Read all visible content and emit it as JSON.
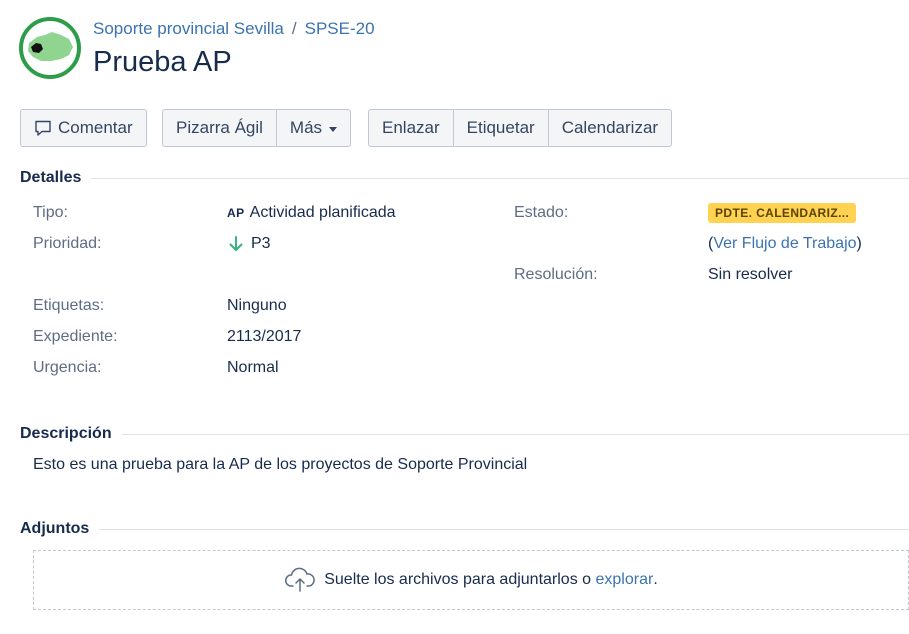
{
  "breadcrumb": {
    "project": "Soporte provincial Sevilla",
    "separator": "/",
    "issue_key": "SPSE-20"
  },
  "issue": {
    "title": "Prueba AP"
  },
  "toolbar": {
    "comment_label": "Comentar",
    "board_label": "Pizarra Ágil",
    "more_label": "Más",
    "link_label": "Enlazar",
    "label_label": "Etiquetar",
    "schedule_label": "Calendarizar"
  },
  "details": {
    "heading": "Detalles",
    "type": {
      "label": "Tipo:",
      "icon_text": "AP",
      "value": "Actividad planificada"
    },
    "priority": {
      "label": "Prioridad:",
      "value": "P3",
      "color": "#36b37e"
    },
    "labels": {
      "label": "Etiquetas:",
      "value": "Ninguno"
    },
    "expediente": {
      "label": "Expediente:",
      "value": "2113/2017"
    },
    "urgency": {
      "label": "Urgencia:",
      "value": "Normal"
    },
    "status": {
      "label": "Estado:",
      "value": "PDTE. CALENDARIZ...",
      "color": "#ffd351",
      "workflow_open": "(",
      "workflow_link": "Ver Flujo de Trabajo",
      "workflow_close": ")"
    },
    "resolution": {
      "label": "Resolución:",
      "value": "Sin resolver"
    }
  },
  "description": {
    "heading": "Descripción",
    "text": "Esto es una prueba para la AP de los proyectos de Soporte Provincial"
  },
  "attachments": {
    "heading": "Adjuntos",
    "drop_text": "Suelte los archivos para adjuntarlos o",
    "browse_link": "explorar",
    "period": "."
  }
}
